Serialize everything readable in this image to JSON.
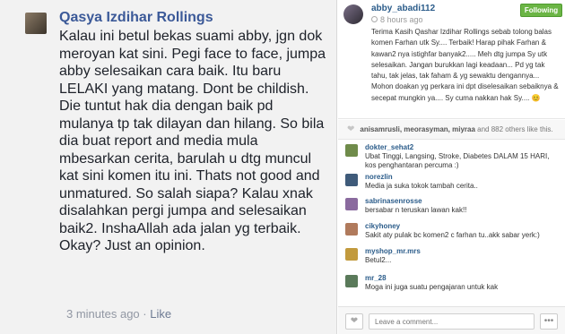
{
  "facebook_comment": {
    "author": "Qasya Izdihar Rollings",
    "text": "Kalau ini betul bekas suami abby, jgn dok meroyan kat sini. Pegi face to face, jumpa abby selesaikan cara baik. Itu baru LELAKI yang matang. Dont be childish. Die tuntut hak dia dengan baik pd mulanya tp tak dilayan dan hilang. So bila dia buat report and media mula mbesarkan cerita, barulah u dtg muncul kat sini komen itu ini. Thats not good and unmatured. So salah siapa? Kalau xnak disalahkan pergi jumpa and selesaikan baik2. InshaAllah ada jalan yg terbaik. Okay? Just an opinion.",
    "time": "3 minutes ago",
    "separator": "·",
    "like_label": "Like"
  },
  "instagram_post": {
    "username": "abby_abadi112",
    "time": "8 hours ago",
    "follow_label": "Following",
    "caption": "Terima Kasih Qashar Izdihar Rollings sebab tolong balas komen Farhan utk Sy.... Terbaik! Harap pihak Farhan & kawan2 nya istighfar banyak2..... Meh dtg jumpa Sy utk selesaikan. Jangan burukkan lagi keadaan... Pd yg tak tahu, tak jelas, tak faham & yg sewaktu dengannya... Mohon doakan yg perkara ini dpt diselesaikan sebaiknya & secepat mungkin ya.... Sy cuma nakkan hak Sy.... 😊",
    "likes_users": "anisamrusli, meorasyman, miyraa",
    "likes_tail": "and 882 others like this.",
    "comment_placeholder": "Leave a comment...",
    "comments": [
      {
        "user": "dokter_sehat2",
        "text": "Ubat Tinggi, Langsing, Stroke, Diabetes DALAM 15 HARI, kos penghantaran percuma :)",
        "color": "#6f8b4a"
      },
      {
        "user": "norezlin",
        "text": "Media ja suka tokok tambah cerita..",
        "color": "#3f5b7a"
      },
      {
        "user": "sabrinasenrosse",
        "text": "bersabar n teruskan lawan kak!!",
        "color": "#8a6a9e"
      },
      {
        "user": "cikyhoney",
        "text": "Sakit aty pulak bc komen2 c farhan tu..akk sabar yerk:)",
        "color": "#b07a5c"
      },
      {
        "user": "myshop_mr.mrs",
        "text": "Betul2...",
        "color": "#c29a3d"
      },
      {
        "user": "mr_28",
        "text": "Moga ini juga suatu pengajaran untuk kak",
        "color": "#5a7a5a"
      }
    ]
  }
}
